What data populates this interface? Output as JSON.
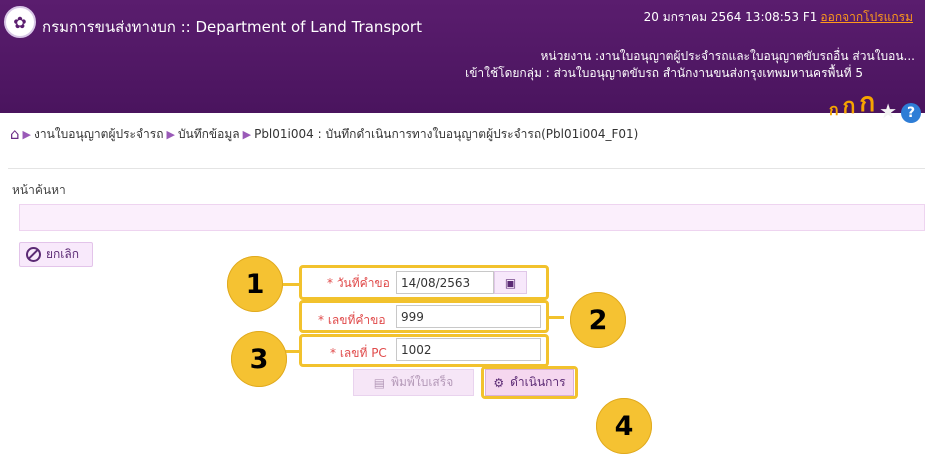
{
  "header": {
    "app_title": "กรมการขนส่งทางบก :: Department of Land Transport",
    "datetime": "20 มกราคม 2564 13:08:53 F1",
    "logout_link": "ออกจากโปรแกรม",
    "unit_line": "หน่วยงาน :งานใบอนุญาตผู้ประจำรถและใบอนุญาตขับรถอื่น ส่วนใบอน...",
    "group_line": "เข้าใช้โดยกลุ่ม : ส่วนใบอนุญาตขับรถ สำนักงานขนส่งกรุงเทพมหานครพื้นที่ 5",
    "font_small": "ก",
    "font_medium": "ก",
    "font_large": "ก",
    "icons": {
      "logo": "logo-emblem-icon",
      "star": "star-icon",
      "help": "help-icon"
    },
    "accent_color": "#4a145e",
    "link_color": "#ff9a1a"
  },
  "breadcrumb": [
    "งานใบอนุญาตผู้ประจำรถ",
    "บันทึกข้อมูล",
    "Pbl01i004 : บันทึกดำเนินการทางใบอนุญาตผู้ประจำรถ(Pbl01i004_F01)"
  ],
  "page": {
    "section_title": "หน้าค้นหา",
    "cancel_label": "ยกเลิก"
  },
  "form": {
    "request_date_label": "* วันที่คำขอ",
    "request_date_value": "14/08/2563",
    "request_no_label": "* เลขที่คำขอ",
    "request_no_value": "999",
    "pc_no_label": "* เลขที่ PC",
    "pc_no_value": "1002"
  },
  "actions": {
    "print_label": "พิมพ์ใบเสร็จ",
    "run_label": "ดำเนินการ"
  },
  "callouts": [
    "1",
    "2",
    "3",
    "4"
  ],
  "callout_color": "#f5c232"
}
